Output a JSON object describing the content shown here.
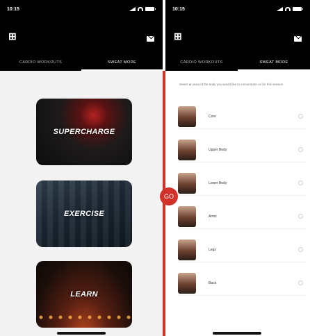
{
  "status_bar": {
    "time_left": "10:15",
    "time_right": "10:15"
  },
  "tabs": {
    "left": "CARDIO WORKOUTS",
    "right": "SWEAT MODE"
  },
  "left_screen": {
    "cards": [
      {
        "label": "SUPERCHARGE"
      },
      {
        "label": "EXERCISE"
      },
      {
        "label": "LEARN"
      }
    ]
  },
  "right_screen": {
    "instructions": "Select an area of the body you would like to concentrate on for this session",
    "items": [
      {
        "label": "Core"
      },
      {
        "label": "Upper Body"
      },
      {
        "label": "Lower Body"
      },
      {
        "label": "Arms"
      },
      {
        "label": "Legs"
      },
      {
        "label": "Back"
      }
    ]
  },
  "fab": {
    "label": "GO"
  },
  "colors": {
    "accent": "#d1322a",
    "appbar": "#000000"
  }
}
